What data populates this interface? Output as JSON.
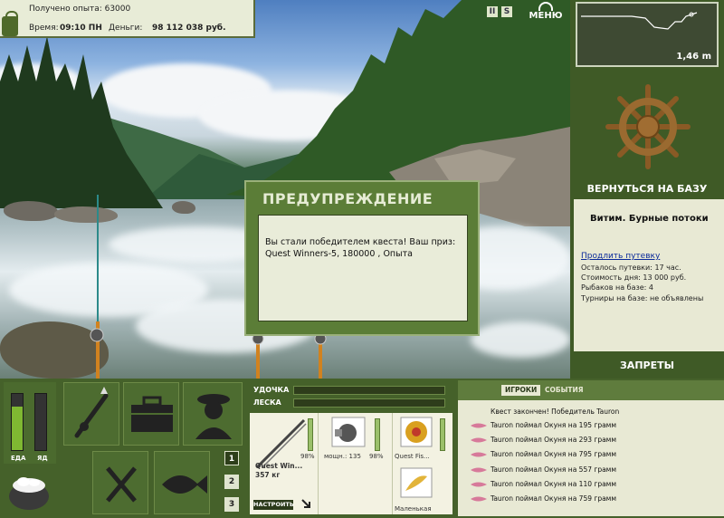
{
  "info": {
    "experience_label": "Получено опыта: 63000",
    "time_label": "Время:",
    "time_value": "09:10 ПН",
    "money_label": "Деньги:",
    "money_value": "98 112 038 руб."
  },
  "top_icons": {
    "pause": "II",
    "sound": "S",
    "menu": "МЕНЮ"
  },
  "depth": {
    "value": "1,46 m"
  },
  "right_panel": {
    "return_base": "ВЕРНУТЬСЯ НА БАЗУ",
    "location_name": "Витим. Бурные потоки",
    "extend_link": "Продлить путевку",
    "remaining": "Осталось путевки: 17 час.",
    "day_cost": "Стоимость дня: 13 000 руб.",
    "fishers": "Рыбаков на базе: 4",
    "tournaments": "Турниры на базе: не объявлены",
    "bans": "ЗАПРЕТЫ"
  },
  "dialog": {
    "title": "ПРЕДУПРЕЖДЕНИЕ",
    "message": "Вы стали победителем квеста! Ваш приз: Quest Winners-5, 180000 , Опыта"
  },
  "status": {
    "food_label": "ЕДА",
    "poison_label": "ЯД",
    "food_level": 0.78,
    "poison_level": 0.0
  },
  "pages": [
    "1",
    "2",
    "3"
  ],
  "tackle": {
    "rod_label": "УДОЧКА",
    "line_label": "ЛЕСКА",
    "rod_percent": "98%",
    "rod_name": "Quest Win...",
    "rod_weight": "357 кг",
    "setup_button": "НАСТРОИТЬ",
    "reel_power": "мощн.: 135",
    "reel_percent": "98%",
    "line_name": "Quest Fis...",
    "lure_name": "Маленькая"
  },
  "events": {
    "tab_players": "ИГРОКИ",
    "tab_events": "СОБЫТИЯ",
    "lines": [
      "Квест закончен! Победитель Tauron",
      "Tauron поймал Окуня на 195 грамм",
      "Tauron поймал Окуня на 293 грамм",
      "Tauron поймал Окуня на 795 грамм",
      "Tauron поймал Окуня на 557 грамм",
      "Tauron поймал Окуня на 110 грамм",
      "Tauron поймал Окуня на 759 грамм"
    ]
  },
  "colors": {
    "panel_green": "#45612a",
    "accent_light": "#e8e9d4",
    "dialog_green": "#5b7d37",
    "link_blue": "#0a2a9a"
  }
}
